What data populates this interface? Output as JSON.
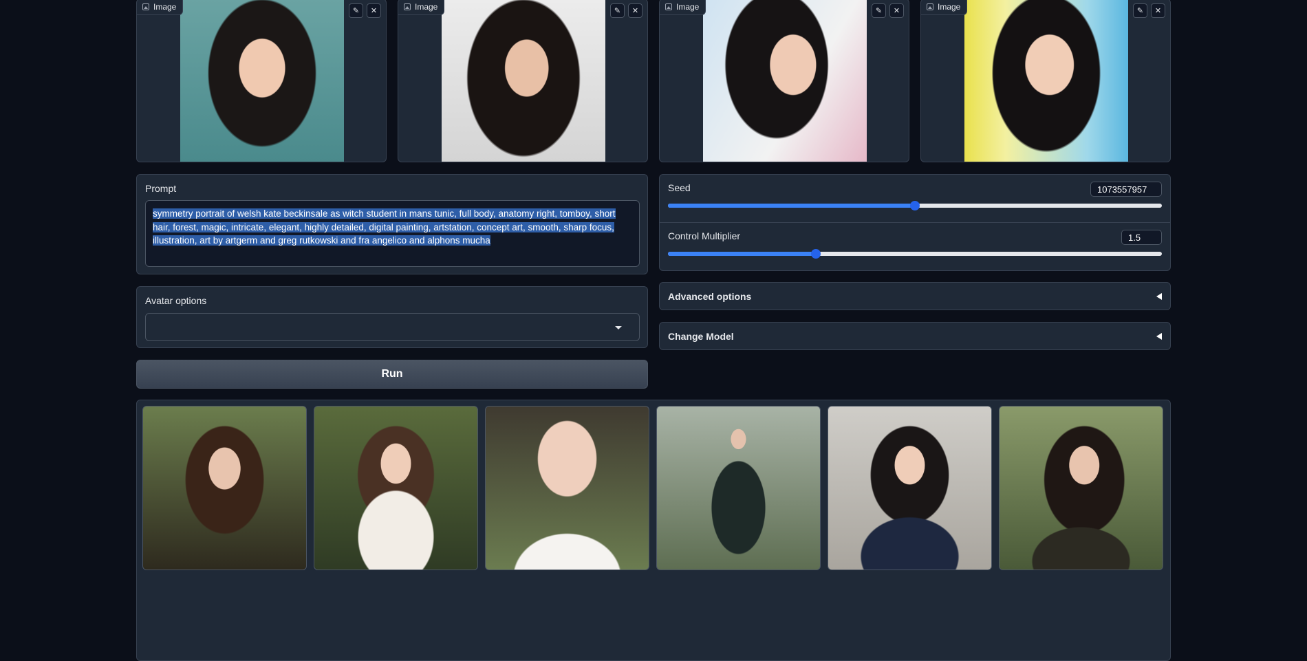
{
  "inputs": {
    "image_label": "Image",
    "edit_icon": "pencil-icon",
    "clear_icon": "close-icon"
  },
  "prompt": {
    "label": "Prompt",
    "value": "symmetry portrait of welsh kate beckinsale as witch student in mans tunic, full body, anatomy right, tomboy, short hair, forest, magic, intricate, elegant, highly detailed, digital painting, artstation, concept art, smooth, sharp focus, illustration, art by artgerm and greg rutkowski and fra angelico and alphons mucha"
  },
  "seed": {
    "label": "Seed",
    "value": "1073557957",
    "fraction": 0.5
  },
  "control_multiplier": {
    "label": "Control Multiplier",
    "value": "1.5",
    "fraction": 0.3
  },
  "avatar_options": {
    "label": "Avatar options",
    "selected": ""
  },
  "advanced_options": {
    "label": "Advanced options"
  },
  "change_model": {
    "label": "Change Model"
  },
  "run_button": {
    "label": "Run"
  },
  "gallery": {
    "count": 6
  },
  "colors": {
    "background": "#0b0f19",
    "panel": "#1f2937",
    "slider_accent": "#2563eb",
    "selection": "#2e5ea8"
  }
}
